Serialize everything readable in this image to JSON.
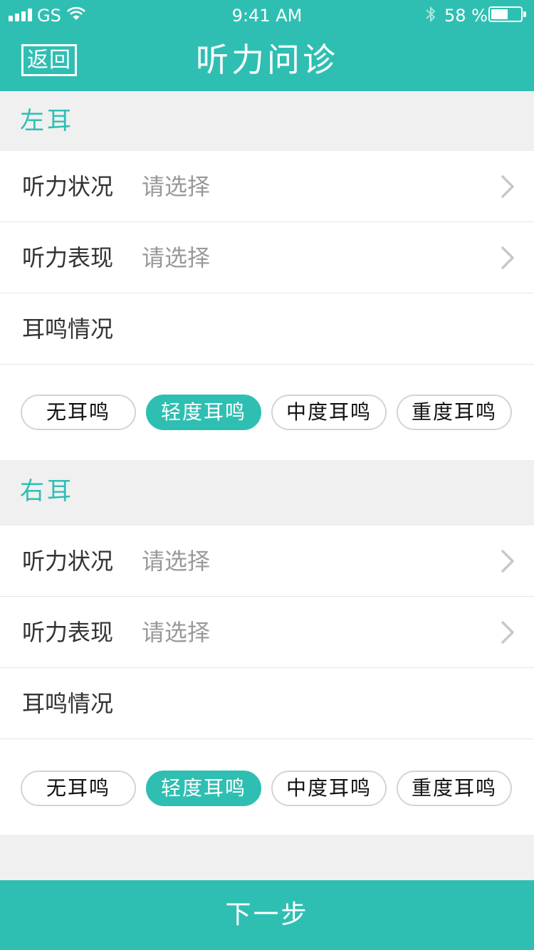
{
  "status_bar": {
    "carrier": "GS",
    "time": "9:41 AM",
    "battery_percent": "58 %",
    "battery_level": 0.58,
    "signal_icon": "signal-bars-icon",
    "wifi_icon": "wifi-icon",
    "bluetooth_icon": "bluetooth-icon",
    "battery_icon": "battery-icon"
  },
  "nav": {
    "back_label": "返回",
    "title": "听力问诊"
  },
  "left_ear": {
    "title": "左耳",
    "hearing_status": {
      "label": "听力状况",
      "placeholder": "请选择"
    },
    "hearing_performance": {
      "label": "听力表现",
      "placeholder": "请选择"
    },
    "tinnitus": {
      "label": "耳鸣情况",
      "options": [
        "无耳鸣",
        "轻度耳鸣",
        "中度耳鸣",
        "重度耳鸣"
      ],
      "selected": "轻度耳鸣"
    }
  },
  "right_ear": {
    "title": "右耳",
    "hearing_status": {
      "label": "听力状况",
      "placeholder": "请选择"
    },
    "hearing_performance": {
      "label": "听力表现",
      "placeholder": "请选择"
    },
    "tinnitus": {
      "label": "耳鸣情况",
      "options": [
        "无耳鸣",
        "轻度耳鸣",
        "中度耳鸣",
        "重度耳鸣"
      ],
      "selected": "轻度耳鸣"
    }
  },
  "footer": {
    "next_label": "下一步"
  },
  "colors": {
    "accent": "#2fbfb2",
    "background": "#f0f0f0",
    "placeholder": "#999999"
  }
}
